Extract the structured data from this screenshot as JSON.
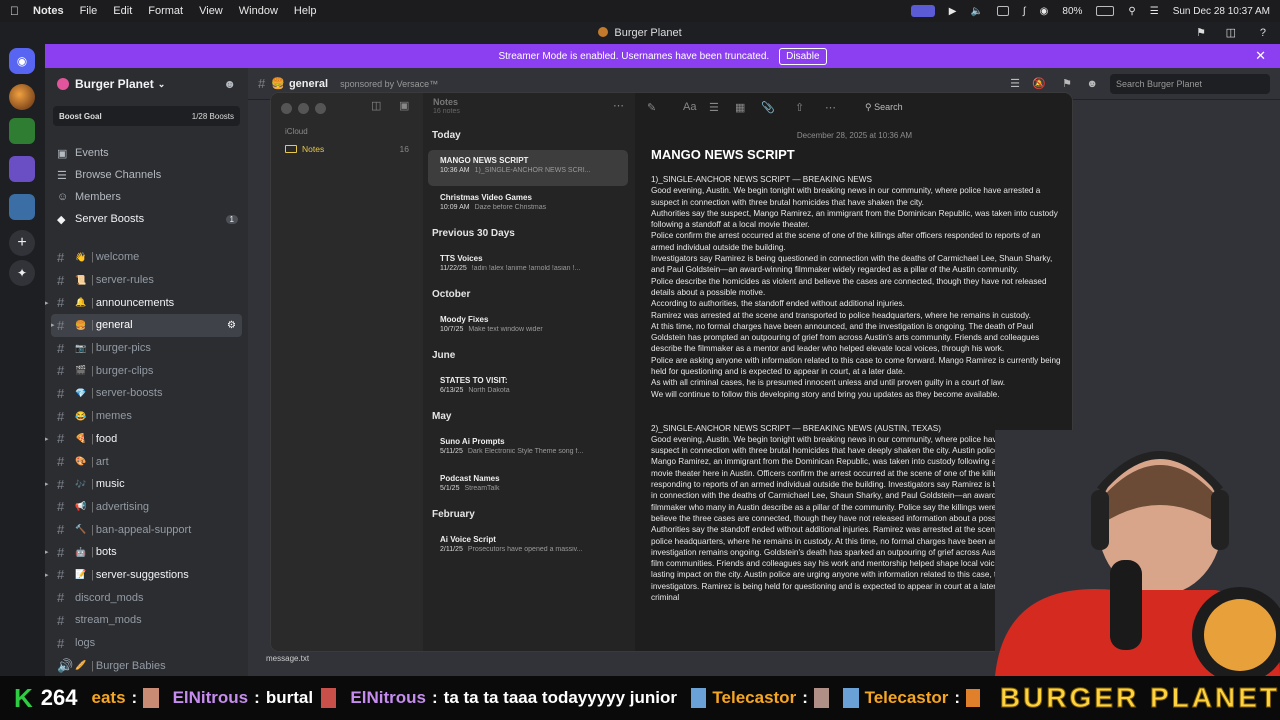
{
  "menubar": {
    "app": "Notes",
    "items": [
      "File",
      "Edit",
      "Format",
      "View",
      "Window",
      "Help"
    ],
    "battery": "80%",
    "clock": "Sun Dec 28  10:37 AM"
  },
  "window_title": "Burger Planet",
  "banner": {
    "text": "Streamer Mode is enabled. Usernames have been truncated.",
    "button": "Disable"
  },
  "server": {
    "name": "Burger Planet",
    "boost_goal": "Boost Goal",
    "boosts": "1/28 Boosts"
  },
  "nav": [
    {
      "label": "Events"
    },
    {
      "label": "Browse Channels"
    },
    {
      "label": "Members"
    },
    {
      "label": "Server Boosts",
      "badge": "1"
    }
  ],
  "channels": [
    {
      "emoji": "👋",
      "name": "welcome"
    },
    {
      "emoji": "📜",
      "name": "server-rules"
    },
    {
      "emoji": "🔔",
      "name": "announcements"
    },
    {
      "emoji": "🍔",
      "name": "general"
    },
    {
      "emoji": "📷",
      "name": "burger-pics"
    },
    {
      "emoji": "🎬",
      "name": "burger-clips"
    },
    {
      "emoji": "💎",
      "name": "server-boosts"
    },
    {
      "emoji": "😂",
      "name": "memes"
    },
    {
      "emoji": "🍕",
      "name": "food"
    },
    {
      "emoji": "🎨",
      "name": "art"
    },
    {
      "emoji": "🎶",
      "name": "music"
    },
    {
      "emoji": "📢",
      "name": "advertising"
    },
    {
      "emoji": "🔨",
      "name": "ban-appeal-support"
    },
    {
      "emoji": "🤖",
      "name": "bots"
    },
    {
      "emoji": "📝",
      "name": "server-suggestions"
    },
    {
      "emoji": "",
      "name": "discord_mods"
    },
    {
      "emoji": "",
      "name": "stream_mods"
    },
    {
      "emoji": "",
      "name": "logs"
    },
    {
      "emoji": "🥖",
      "name": "Burger Babies"
    }
  ],
  "chat": {
    "channel": "general",
    "sponsor": "sponsored by Versace™",
    "search_placeholder": "Search Burger Planet",
    "file_label": "message.txt"
  },
  "notes_app": {
    "window_title": "Notes",
    "count": "16 notes",
    "sidebar_group": "iCloud",
    "folder": "Notes",
    "folder_count": "16",
    "search_label": "Search",
    "sections": [
      {
        "label": "Today",
        "notes": [
          {
            "title": "MANGO NEWS SCRIPT",
            "date": "10:36 AM",
            "snippet": "1)_SINGLE-ANCHOR NEWS SCRI..."
          },
          {
            "title": "Christmas Video Games",
            "date": "10:09 AM",
            "snippet": "Daze before Christmas"
          }
        ]
      },
      {
        "label": "Previous 30 Days",
        "notes": [
          {
            "title": "TTS Voices",
            "date": "11/22/25",
            "snippet": "!adin !alex !anime !arnold !asian !..."
          }
        ]
      },
      {
        "label": "October",
        "notes": [
          {
            "title": "Moody Fixes",
            "date": "10/7/25",
            "snippet": "Make text window wider"
          }
        ]
      },
      {
        "label": "June",
        "notes": [
          {
            "title": "STATES TO VISIT:",
            "date": "6/13/25",
            "snippet": "North Dakota"
          }
        ]
      },
      {
        "label": "May",
        "notes": [
          {
            "title": "Suno Ai Prompts",
            "date": "5/11/25",
            "snippet": "Dark Electronic Style Theme song f..."
          },
          {
            "title": "Podcast Names",
            "date": "5/1/25",
            "snippet": "StreamTalk"
          }
        ]
      },
      {
        "label": "February",
        "notes": [
          {
            "title": "Ai Voice Script",
            "date": "2/11/25",
            "snippet": "Prosecutors have opened a massiv..."
          }
        ]
      }
    ],
    "note": {
      "timestamp": "December 28, 2025 at 10:36 AM",
      "title": "MANGO NEWS SCRIPT",
      "lines": [
        "1)_SINGLE-ANCHOR NEWS SCRIPT — BREAKING NEWS",
        "Good evening, Austin. We begin tonight with breaking news in our community, where police have arrested a suspect in connection with three brutal homicides that have shaken the city.",
        "Authorities say the suspect, Mango Ramirez, an immigrant from the Dominican Republic, was taken into custody following a standoff at a local movie theater.",
        "Police confirm the arrest occurred at the scene of one of the killings after officers responded to reports of an armed individual outside the building.",
        "Investigators say Ramirez is being questioned in connection with the deaths of Carmichael Lee, Shaun Sharky, and Paul Goldstein—an award-winning filmmaker widely regarded as a pillar of the Austin community.",
        "Police describe the homicides as violent and believe the cases are connected, though they have not released details about a possible motive.",
        "According to authorities, the standoff ended without additional injuries.",
        "Ramirez was arrested at the scene and transported to police headquarters, where he remains in custody.",
        "At this time, no formal charges have been announced, and the investigation is ongoing. The death of Paul Goldstein has prompted an outpouring of grief from across Austin's arts community. Friends and colleagues describe the filmmaker as a mentor and leader who helped elevate local voices, through his work.",
        "Police are asking anyone with information related to this case to come forward. Mango Ramirez is currently being held for questioning and is expected to appear in court, at a later date.",
        "As with all criminal cases, he is presumed innocent unless and until proven guilty in a court of law.",
        "We will continue to follow this developing story and bring you updates as they become available.",
        "",
        "",
        "2)_SINGLE-ANCHOR NEWS SCRIPT — BREAKING NEWS (AUSTIN, TEXAS)",
        "Good evening, Austin. We begin tonight with breaking news in our community, where police have arrested a suspect in connection with three brutal homicides that have deeply shaken the city. Austin police say the suspect, Mango Ramirez, an immigrant from the Dominican Republic, was taken into custody following a standoff at a local movie theater here in Austin. Officers confirm the arrest occurred at the scene of one of the killings, after responding to reports of an armed individual outside the building. Investigators say Ramirez is being questioned in connection with the deaths of Carmichael Lee, Shaun Sharky, and Paul Goldstein—an award-winning filmmaker who many in Austin describe as a pillar of the community. Police say the killings were violent and believe the three cases are connected, though they have not released information about a possible motive. Authorities say the standoff ended without additional injuries. Ramirez was arrested at the scene and taken to police headquarters, where he remains in custody. At this time, no formal charges have been announced, and the investigation remains ongoing. Goldstein's death has sparked an outpouring of grief across Austin's creative and film communities. Friends and colleagues say his work and mentorship helped shape local voices and left a lasting impact on the city. Austin police are urging anyone with information related to this case, to contact investigators. Ramirez is being held for questioning and is expected to appear in court at a later date. As with all criminal"
      ]
    }
  },
  "ticker": {
    "count": "264",
    "messages": [
      {
        "user": "eats",
        "text": ""
      },
      {
        "user": "ElNitrous",
        "text": "burtal"
      },
      {
        "user": "ElNitrous",
        "text": "ta ta ta taaa todayyyyy junior"
      },
      {
        "user": "Telecastor",
        "text": ""
      },
      {
        "user": "Telecastor",
        "text": ""
      }
    ],
    "brand": "BURGER PLANET"
  },
  "colors": {
    "accent": "#8b3ff0",
    "ticker_user": "#f5a623",
    "ticker_brand": "#ffd23f",
    "ticker_count": "#2ecc40"
  }
}
